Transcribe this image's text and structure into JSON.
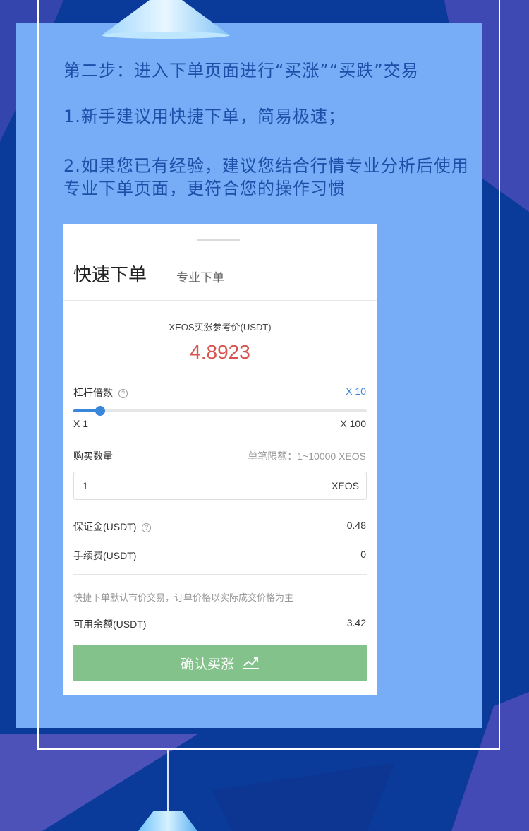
{
  "colors": {
    "background": "#0a3a9a",
    "panel": "#77adf7",
    "instruction_text": "#1d4fa8",
    "price_red": "#d9534f",
    "accent_blue": "#3a86d9",
    "confirm_green": "#84c28b"
  },
  "instructions": {
    "step_title": "第二步：进入下单页面进行“买涨”“买跌”交易",
    "tip1": "1.新手建议用快捷下单，简易极速；",
    "tip2": "2.如果您已有经验，建议您结合行情专业分析后使用专业下单页面，更符合您的操作习惯"
  },
  "order": {
    "tabs": {
      "quick": "快速下单",
      "pro": "专业下单"
    },
    "ref_price_label": "XEOS买涨参考价(USDT)",
    "ref_price": "4.8923",
    "leverage": {
      "label": "杠杆倍数",
      "value_label": "X 10",
      "min_label": "X 1",
      "max_label": "X 100",
      "min": 1,
      "max": 100,
      "value": 10
    },
    "quantity": {
      "label": "购买数量",
      "limit": "单笔限额：1~10000 XEOS",
      "value": "1",
      "unit": "XEOS"
    },
    "margin": {
      "label": "保证金(USDT)",
      "value": "0.48"
    },
    "fee": {
      "label": "手续费(USDT)",
      "value": "0"
    },
    "note": "快捷下单默认市价交易，订单价格以实际成交价格为主",
    "available": {
      "label": "可用余额(USDT)",
      "value": "3.42"
    },
    "confirm_label": "确认买涨",
    "confirm_icon": "trend-up-icon",
    "help_icon": "help-circle-icon"
  }
}
